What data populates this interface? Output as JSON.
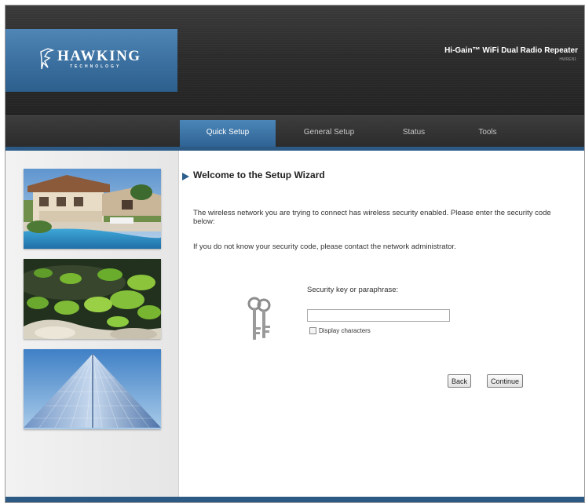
{
  "header": {
    "logo_text": "HAWKING",
    "logo_sub": "TECHNOLOGY",
    "product_title": "Hi-Gain™ WiFi Dual Radio Repeater",
    "product_model": "HWREN1"
  },
  "nav": {
    "tabs": [
      {
        "label": "Quick Setup",
        "active": true
      },
      {
        "label": "General Setup",
        "active": false
      },
      {
        "label": "Status",
        "active": false
      },
      {
        "label": "Tools",
        "active": false
      }
    ]
  },
  "sidebar": {
    "images": [
      "house-pool-photo",
      "lily-pond-photo",
      "glass-pyramid-photo"
    ]
  },
  "main": {
    "title": "Welcome to the Setup Wizard",
    "paragraph1": "The wireless network you are trying to connect has wireless security enabled. Please enter the security code below:",
    "paragraph2": "If you do not know your security code, please contact the network administrator.",
    "security_label": "Security key or paraphrase:",
    "security_value": "",
    "display_characters_label": "Display characters",
    "display_characters_checked": false,
    "back_label": "Back",
    "continue_label": "Continue"
  },
  "colors": {
    "accent_blue": "#2e5f8c",
    "header_dark": "#2c2c2c",
    "tab_active": "#3b72a4"
  }
}
